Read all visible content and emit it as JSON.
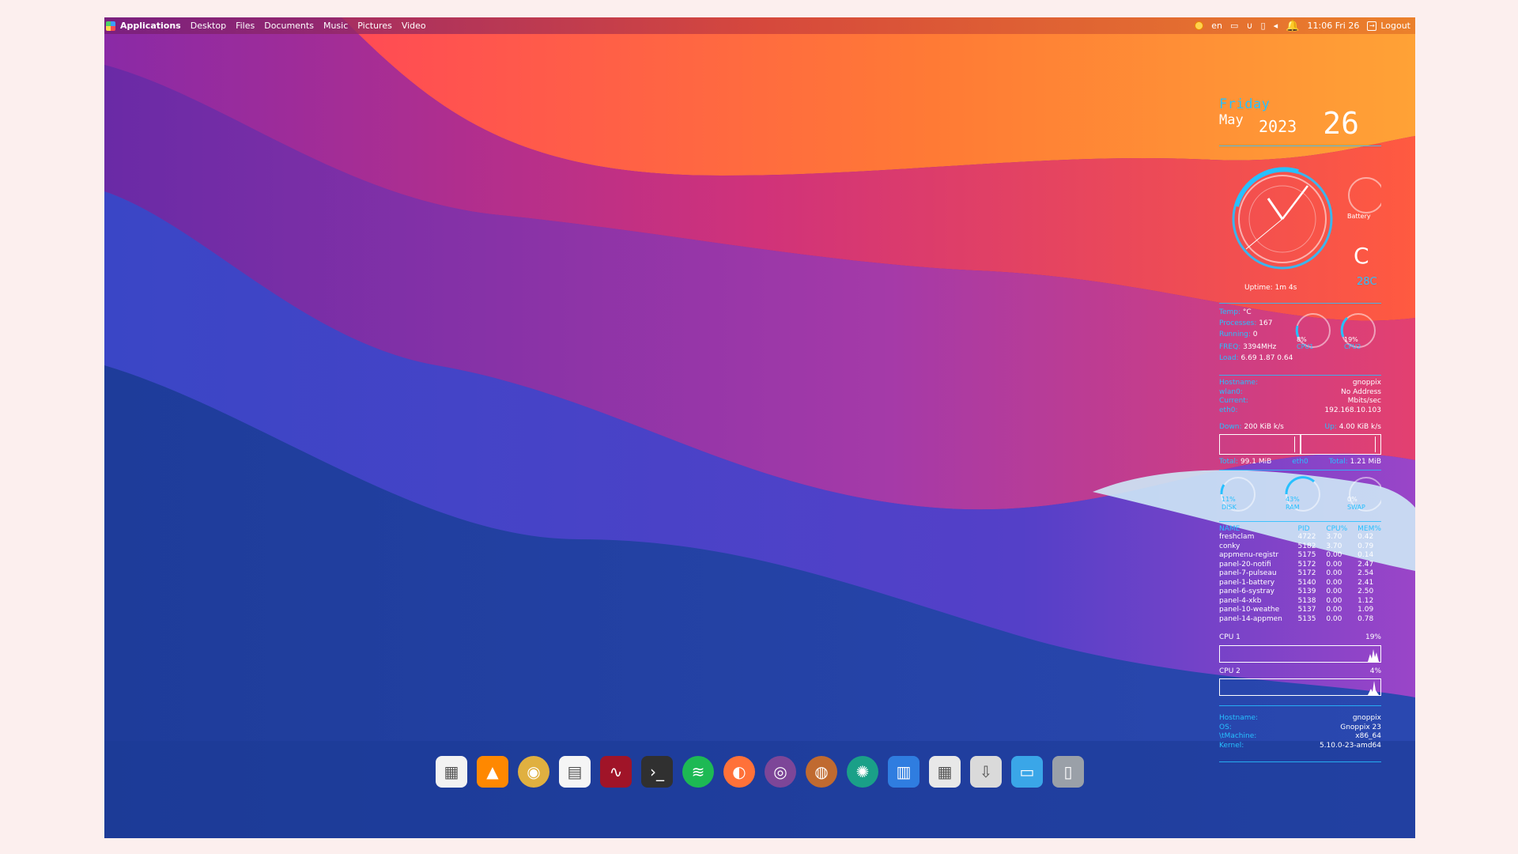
{
  "topbar": {
    "apps_label": "Applications",
    "menu": [
      "Desktop",
      "Files",
      "Documents",
      "Music",
      "Pictures",
      "Video"
    ],
    "lang": "en",
    "clock": "11:06 Fri 26",
    "logout": "Logout"
  },
  "conky": {
    "date": {
      "day": "Friday",
      "month": "May",
      "year": "2023",
      "daynum": "26"
    },
    "uptime": "Uptime: 1m 4s",
    "battery_label": "Battery",
    "temp_big": "C",
    "temp_sub": "28C",
    "system": {
      "temp_label": "Temp:",
      "temp_value": "°C",
      "processes_label": "Processes:",
      "processes_value": "167",
      "running_label": "Running:",
      "running_value": "0",
      "freq_label": "FREQ:",
      "freq_value": "3394MHz",
      "load_label": "Load:",
      "load_value": "6.69 1.87 0.64",
      "cpu1_pct": "8%",
      "cpu1_label": "CPU1",
      "cpu2_pct": "19%",
      "cpu2_label": "CPU2"
    },
    "network": {
      "hostname_label": "Hostname:",
      "hostname_value": "gnoppix",
      "wlan_label": "wlan0:",
      "wlan_value": "No Address",
      "current_label": "Current:",
      "current_value": "Mbits/sec",
      "eth_label": "eth0:",
      "eth_value": "192.168.10.103",
      "down_label": "Down:",
      "down_value": "200 KiB k/s",
      "up_label": "Up:",
      "up_value": "4.00 KiB k/s",
      "total_down_label": "Total:",
      "total_down_value": "99.1 MiB",
      "iface": "eth0",
      "total_up_label": "Total:",
      "total_up_value": "1.21 MiB"
    },
    "usage": {
      "disk_pct": "11%",
      "disk_label": "DISK",
      "ram_pct": "43%",
      "ram_label": "RAM",
      "swap_pct": "0%",
      "swap_label": "SWAP"
    },
    "processes": {
      "headers": [
        "NAME",
        "PID",
        "CPU%",
        "MEM%"
      ],
      "rows": [
        [
          "freshclam",
          "4722",
          "3.70",
          "0.42"
        ],
        [
          "conky",
          "5182",
          "3.70",
          "0.79"
        ],
        [
          "appmenu-registr",
          "5175",
          "0.00",
          "0.14"
        ],
        [
          "panel-20-notifi",
          "5172",
          "0.00",
          "2.47"
        ],
        [
          "panel-7-pulseau",
          "5172",
          "0.00",
          "2.54"
        ],
        [
          "panel-1-battery",
          "5140",
          "0.00",
          "2.41"
        ],
        [
          "panel-6-systray",
          "5139",
          "0.00",
          "2.50"
        ],
        [
          "panel-4-xkb",
          "5138",
          "0.00",
          "1.12"
        ],
        [
          "panel-10-weathe",
          "5137",
          "0.00",
          "1.09"
        ],
        [
          "panel-14-appmen",
          "5135",
          "0.00",
          "0.78"
        ]
      ]
    },
    "cpu_graphs": [
      {
        "label": "CPU 1",
        "value": "19%"
      },
      {
        "label": "CPU 2",
        "value": "4%"
      }
    ],
    "sysinfo": {
      "hostname_label": "Hostname:",
      "hostname_value": "gnoppix",
      "os_label": "OS:",
      "os_value": "Gnoppix 23",
      "machine_label": "\\tMachine:",
      "machine_value": "x86_64",
      "kernel_label": "Kernel:",
      "kernel_value": "5.10.0-23-amd64"
    }
  },
  "colors": {
    "accent": "#27c0ff"
  },
  "dock": [
    {
      "name": "app-grid-icon",
      "color": "#f2f2f2"
    },
    {
      "name": "vlc-icon",
      "color": "#ff8800"
    },
    {
      "name": "browser-icon",
      "color": "#e0b040"
    },
    {
      "name": "document-icon",
      "color": "#f5f5f5"
    },
    {
      "name": "libreoffice-icon",
      "color": "#a01428"
    },
    {
      "name": "terminal-icon",
      "color": "#303030"
    },
    {
      "name": "spotify-icon",
      "color": "#1db954"
    },
    {
      "name": "firefox-icon",
      "color": "#ff7139"
    },
    {
      "name": "tor-browser-icon",
      "color": "#7d4698"
    },
    {
      "name": "image-viewer-icon",
      "color": "#c06a30"
    },
    {
      "name": "aperture-icon",
      "color": "#1aa088"
    },
    {
      "name": "file-cabinet-icon",
      "color": "#2f7de0"
    },
    {
      "name": "calculator-icon",
      "color": "#e8e8e8"
    },
    {
      "name": "software-store-icon",
      "color": "#dadada"
    },
    {
      "name": "desktop-icon",
      "color": "#3aa6e8"
    },
    {
      "name": "trash-icon",
      "color": "#9aa0a8"
    }
  ]
}
